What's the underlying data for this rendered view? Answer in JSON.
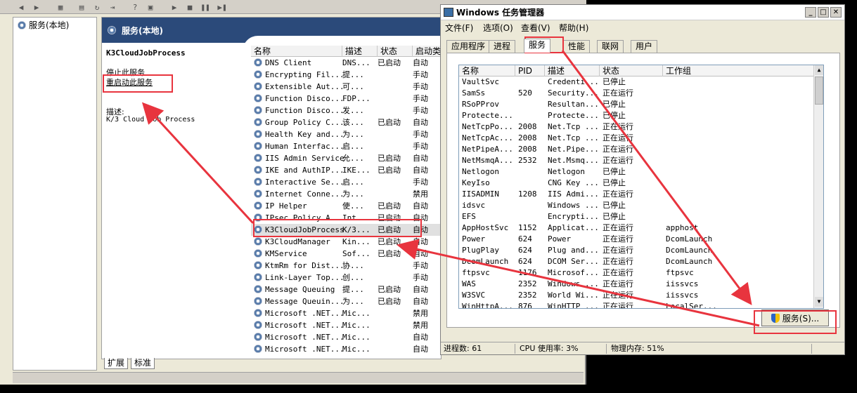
{
  "services_window": {
    "tree_label": "服务(本地)",
    "header_title": "服务(本地)",
    "selected_name": "K3CloudJobProcess",
    "stop_link": "停止此服务",
    "restart_link": "重启动此服务",
    "desc_label": "描述:",
    "desc_text": "K/3 Cloud Job Process",
    "columns": [
      "名称",
      "描述",
      "状态",
      "启动类"
    ],
    "rows": [
      [
        "DNS Client",
        "DNS...",
        "已启动",
        "自动"
      ],
      [
        "Encrypting Fil...",
        "提...",
        "",
        "手动"
      ],
      [
        "Extensible Aut...",
        "可...",
        "",
        "手动"
      ],
      [
        "Function Disco...",
        "FDP...",
        "",
        "手动"
      ],
      [
        "Function Disco...",
        "发...",
        "",
        "手动"
      ],
      [
        "Group Policy C...",
        "该...",
        "已启动",
        "自动"
      ],
      [
        "Health Key and...",
        "为...",
        "",
        "手动"
      ],
      [
        "Human Interfac...",
        "启...",
        "",
        "手动"
      ],
      [
        "IIS Admin Service",
        "允...",
        "已启动",
        "自动"
      ],
      [
        "IKE and AuthIP...",
        "IKE...",
        "已启动",
        "自动"
      ],
      [
        "Interactive Se...",
        "启...",
        "",
        "手动"
      ],
      [
        "Internet Conne...",
        "为...",
        "",
        "禁用"
      ],
      [
        "IP Helper",
        "使...",
        "已启动",
        "自动"
      ],
      [
        "IPsec Policy A...",
        "Int...",
        "已启动",
        "自动"
      ],
      [
        "K3CloudJobProcess",
        "K/3...",
        "已启动",
        "自动"
      ],
      [
        "K3CloudManager",
        "Kin...",
        "已启动",
        "自动"
      ],
      [
        "KMService",
        "Sof...",
        "已启动",
        "自动"
      ],
      [
        "KtmRm for Dist...",
        "协...",
        "",
        "手动"
      ],
      [
        "Link-Layer Top...",
        "创...",
        "",
        "手动"
      ],
      [
        "Message Queuing",
        "提...",
        "已启动",
        "自动"
      ],
      [
        "Message Queuin...",
        "为...",
        "已启动",
        "自动"
      ],
      [
        "Microsoft .NET...",
        "Mic...",
        "",
        "禁用"
      ],
      [
        "Microsoft .NET...",
        "Mic...",
        "",
        "禁用"
      ],
      [
        "Microsoft .NET...",
        "Mic...",
        "",
        "自动"
      ],
      [
        "Microsoft .NET...",
        "Mic...",
        "",
        "自动"
      ]
    ],
    "bottom_tabs": [
      "扩展",
      "标准"
    ]
  },
  "task_manager": {
    "title": "Windows 任务管理器",
    "menu": [
      "文件(F)",
      "选项(O)",
      "查看(V)",
      "帮助(H)"
    ],
    "tabs": [
      "应用程序",
      "进程",
      "服务",
      "性能",
      "联网",
      "用户"
    ],
    "active_tab": "服务",
    "columns": [
      "名称",
      "PID",
      "描述",
      "状态",
      "工作组"
    ],
    "rows": [
      [
        "VaultSvc",
        "",
        "Credenti...",
        "已停止",
        ""
      ],
      [
        "SamSs",
        "520",
        "Security...",
        "正在运行",
        ""
      ],
      [
        "RSoPProv",
        "",
        "Resultan...",
        "已停止",
        ""
      ],
      [
        "Protecte...",
        "",
        "Protecte...",
        "已停止",
        ""
      ],
      [
        "NetTcpPo...",
        "2008",
        "Net.Tcp ...",
        "正在运行",
        ""
      ],
      [
        "NetTcpAc...",
        "2008",
        "Net.Tcp ...",
        "正在运行",
        ""
      ],
      [
        "NetPipeA...",
        "2008",
        "Net.Pipe...",
        "正在运行",
        ""
      ],
      [
        "NetMsmqA...",
        "2532",
        "Net.Msmq...",
        "正在运行",
        ""
      ],
      [
        "Netlogon",
        "",
        "Netlogon",
        "已停止",
        ""
      ],
      [
        "KeyIso",
        "",
        "CNG Key ...",
        "已停止",
        ""
      ],
      [
        "IISADMIN",
        "1208",
        "IIS Admi...",
        "正在运行",
        ""
      ],
      [
        "idsvc",
        "",
        "Windows ...",
        "已停止",
        ""
      ],
      [
        "EFS",
        "",
        "Encrypti...",
        "已停止",
        ""
      ],
      [
        "AppHostSvc",
        "1152",
        "Applicat...",
        "正在运行",
        "apphost"
      ],
      [
        "Power",
        "624",
        "Power",
        "正在运行",
        "DcomLaunch"
      ],
      [
        "PlugPlay",
        "624",
        "Plug and...",
        "正在运行",
        "DcomLaunch"
      ],
      [
        "DcomLaunch",
        "624",
        "DCOM Ser...",
        "正在运行",
        "DcomLaunch"
      ],
      [
        "ftpsvc",
        "1176",
        "Microsof...",
        "正在运行",
        "ftpsvc"
      ],
      [
        "WAS",
        "2352",
        "Windows ...",
        "正在运行",
        "iissvcs"
      ],
      [
        "W3SVC",
        "2352",
        "World Wi...",
        "正在运行",
        "iissvcs"
      ],
      [
        "WinHttpA...",
        "876",
        "WinHTTP ...",
        "正在运行",
        "LocalSer..."
      ]
    ],
    "services_button": "服务(S)...",
    "status_processes": "进程数: 61",
    "status_cpu": "CPU 使用率: 3%",
    "status_mem": "物理内存: 51%"
  },
  "annotation_color": "#e8343e"
}
